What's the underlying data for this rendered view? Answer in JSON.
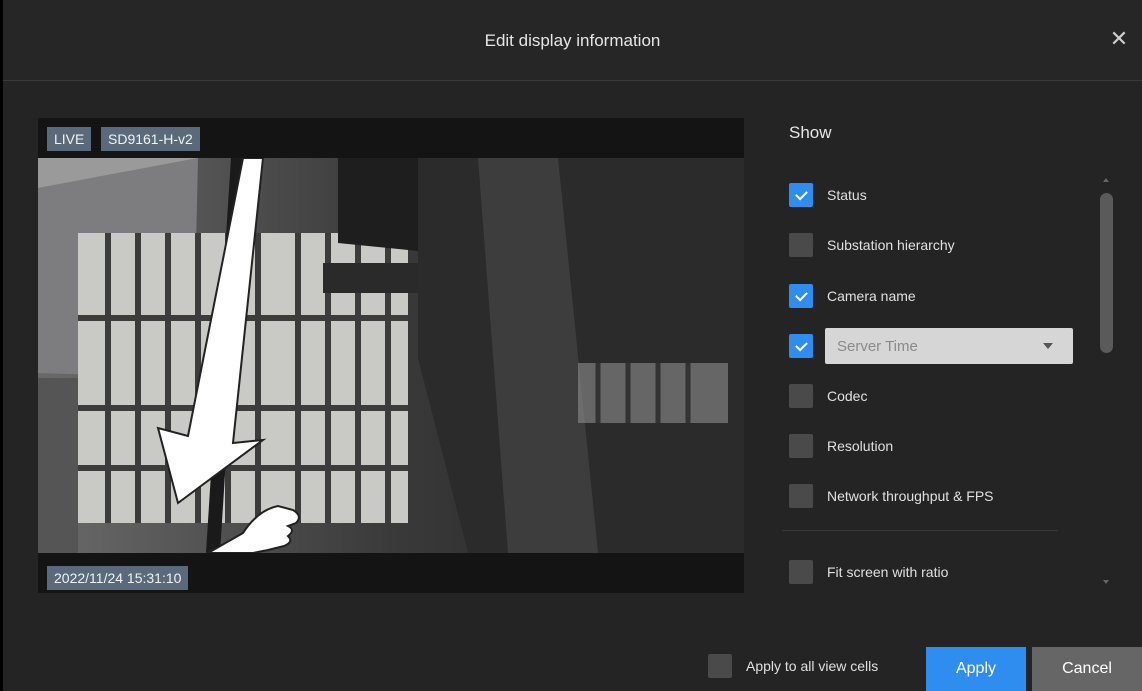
{
  "dialog": {
    "title": "Edit display information",
    "close_icon": "close-icon"
  },
  "preview": {
    "live_label": "LIVE",
    "camera_name": "SD9161-H-v2",
    "timestamp": "2022/11/24 15:31:10"
  },
  "panel": {
    "title": "Show",
    "options": [
      {
        "label": "Status",
        "checked": true
      },
      {
        "label": "Substation hierarchy",
        "checked": false
      },
      {
        "label": "Camera name",
        "checked": true
      },
      {
        "label": "Server Time",
        "checked": true,
        "type": "select"
      },
      {
        "label": "Codec",
        "checked": false
      },
      {
        "label": "Resolution",
        "checked": false
      },
      {
        "label": "Network throughput & FPS",
        "checked": false
      },
      {
        "label": "Fit screen with ratio",
        "checked": false
      }
    ]
  },
  "footer": {
    "apply_all_label": "Apply to all view cells",
    "apply_all_checked": false,
    "apply_label": "Apply",
    "cancel_label": "Cancel"
  },
  "colors": {
    "accent": "#2f8df0",
    "dialog_bg": "#242424",
    "tag_bg": "#5b6a7a"
  }
}
